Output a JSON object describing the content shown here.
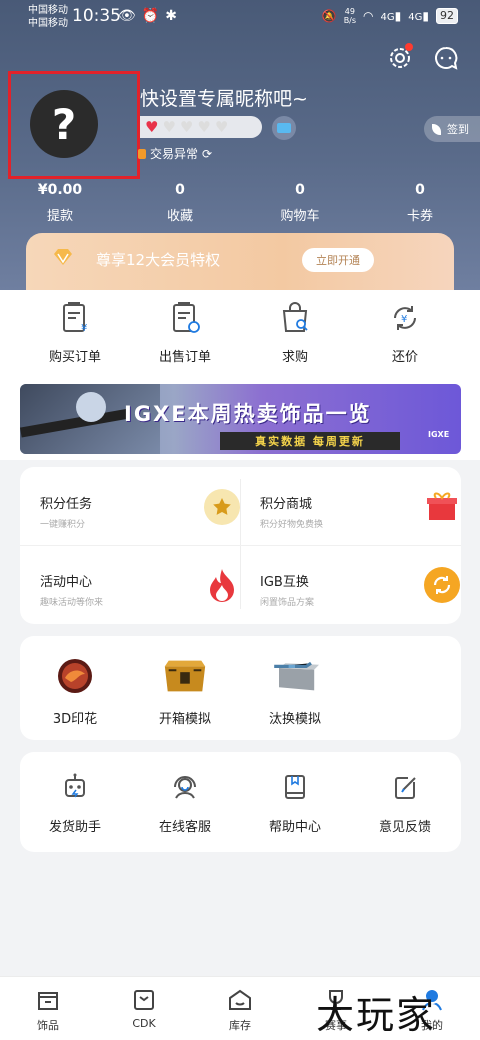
{
  "status_bar": {
    "carrier_1": "中国移动",
    "carrier_2": "中国移动",
    "time": "10:35",
    "net_speed_value": "49",
    "net_speed_unit": "B/s",
    "signal_1": "4G",
    "signal_2": "4G",
    "battery": "92"
  },
  "profile": {
    "avatar_glyph": "?",
    "nickname": "快设置专属昵称吧~",
    "hearts_filled": 1,
    "hearts_total": 5,
    "trade_status": "交易异常",
    "signin_label": "签到"
  },
  "stats": [
    {
      "value": "¥0.00",
      "label": "提款"
    },
    {
      "value": "0",
      "label": "收藏"
    },
    {
      "value": "0",
      "label": "购物车"
    },
    {
      "value": "0",
      "label": "卡券"
    }
  ],
  "vip": {
    "text": "尊享12大会员特权",
    "button": "立即开通"
  },
  "orders": [
    {
      "label": "购买订单",
      "icon": "purchase-order-icon"
    },
    {
      "label": "出售订单",
      "icon": "sell-order-icon"
    },
    {
      "label": "求购",
      "icon": "wanted-icon"
    },
    {
      "label": "还价",
      "icon": "counter-offer-icon"
    }
  ],
  "banner": {
    "title": "IGXE本周热卖饰品一览",
    "subtitle": "真实数据 每周更新",
    "logo": "IGXE"
  },
  "points": [
    {
      "title": "积分任务",
      "sub": "一键赚积分",
      "icon": "star-icon",
      "color": "#f7e6b0"
    },
    {
      "title": "积分商城",
      "sub": "积分好物免费换",
      "icon": "gift-icon",
      "color": "#e8383d"
    },
    {
      "title": "活动中心",
      "sub": "趣味活动等你来",
      "icon": "flame-icon",
      "color": "#e8383d"
    },
    {
      "title": "IGB互换",
      "sub": "闲置饰品方案",
      "icon": "exchange-icon",
      "color": "#f5a623"
    }
  ],
  "tools": [
    {
      "label": "3D印花",
      "icon": "sticker-icon"
    },
    {
      "label": "开箱模拟",
      "icon": "case-icon"
    },
    {
      "label": "汰换模拟",
      "icon": "tradeup-icon"
    }
  ],
  "services": [
    {
      "label": "发货助手",
      "icon": "robot-icon"
    },
    {
      "label": "在线客服",
      "icon": "headset-icon"
    },
    {
      "label": "帮助中心",
      "icon": "book-icon"
    },
    {
      "label": "意见反馈",
      "icon": "pen-icon"
    }
  ],
  "nav": [
    {
      "label": "饰品",
      "icon": "skins-icon"
    },
    {
      "label": "CDK",
      "icon": "cdk-icon"
    },
    {
      "label": "库存",
      "icon": "inventory-icon"
    },
    {
      "label": "赛事",
      "icon": "trophy-icon"
    },
    {
      "label": "我的",
      "icon": "profile-icon"
    }
  ],
  "watermark": "大玩家",
  "colors": {
    "header": "#5a6b8a",
    "accent_red": "#e2222a",
    "icon_gray": "#555555"
  }
}
